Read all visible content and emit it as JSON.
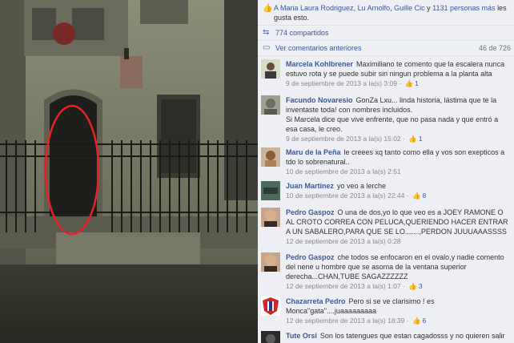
{
  "likes_bar": {
    "names": [
      "A Maria Laura Rodriguez",
      "Lu Arnolfo",
      "Guille Cic"
    ],
    "count_text": "1131 personas más",
    "suffix": "les gusta esto."
  },
  "shares": {
    "text": "774 compartidos"
  },
  "previous_comments": {
    "label": "Ver comentarios anteriores",
    "count": "46 de 726"
  },
  "comments": [
    {
      "author": "Marcela Kohlbrener",
      "text": "Maximiliano te comento que la escalera nunca estuvo rota y se puede subir sin ningun problema a la planta alta",
      "date": "9 de septiembre de 2013 a la(s) 3:09",
      "likes": "1"
    },
    {
      "author": "Facundo Novaresio",
      "text": "GonZa Lxu... linda historia, lástima que te la inventaste toda! con nombres incluidos.",
      "text2": "Si Marcela dice que vive enfrente, que no pasa nada y que entró a esa casa, le creo.",
      "date": "9 de septiembre de 2013 a la(s) 15:02",
      "likes": "1"
    },
    {
      "author": "Maru de la Peña",
      "text": "le creees xq tanto como ella y vos son exepticos a tdo lo sobrenatural..",
      "date": "10 de septiembre de 2013 a la(s) 2:51",
      "likes": ""
    },
    {
      "author": "Juan Martinez",
      "text": "yo veo a lerche",
      "date": "10 de septiembre de 2013 a la(s) 22:44",
      "likes": "8"
    },
    {
      "author": "Pedro Gaspoz",
      "text": "O una de dos,yo lo que veo es a JOEY RAMONE O AL CROTO CORREA CON PELUCA,QUERIENDO HACER ENTRAR A UN SABALERO,PARA QUE SE LO.......,PERDON JUUUAAASSSS",
      "date": "12 de septiembre de 2013 a la(s) 0:28",
      "likes": ""
    },
    {
      "author": "Pedro Gaspoz",
      "text": "che todos se enfocaron en el ovalo,y nadie comento del nene u hombre que se asoma de la ventana superior derecha...CHAN,TUBE SAGAZZZZZZ",
      "date": "12 de septiembre de 2013 a la(s) 1:07",
      "likes": "3"
    },
    {
      "author": "Chazarreta Pedro",
      "text": "Pero si se ve clarisimo ! es Monca\"gata\"....juaaaaaaaaa",
      "date": "12 de septiembre de 2013 a la(s) 18:39",
      "likes": "6"
    },
    {
      "author": "Tute Orsi",
      "text": "Son los tatengues que estan cagadosss y no quieren salir",
      "date": "",
      "likes": ""
    }
  ],
  "colors": {
    "link": "#3b5998",
    "panel_bg": "#edeff4",
    "oval": "#e8202a"
  }
}
